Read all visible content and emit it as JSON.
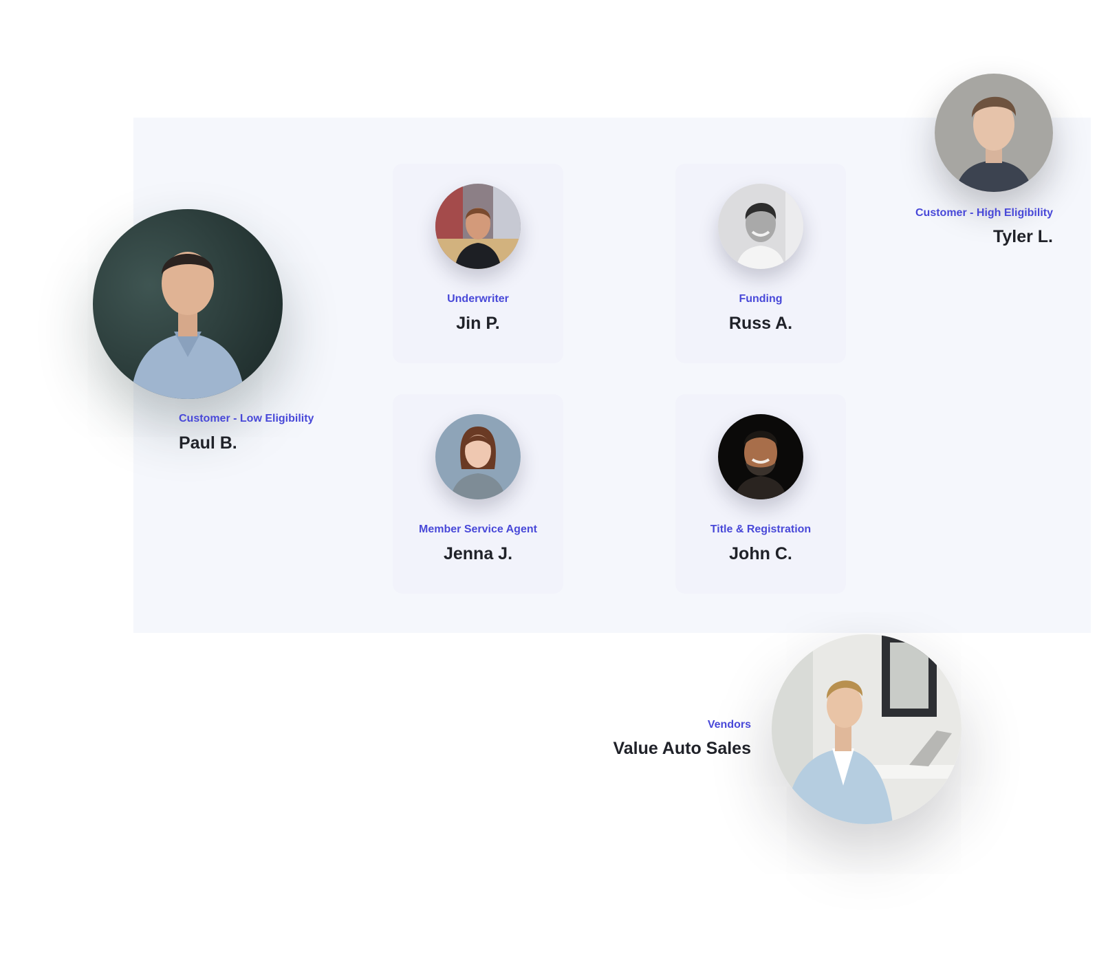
{
  "people": {
    "low": {
      "role": "Customer - Low Eligibility",
      "name": "Paul B."
    },
    "high": {
      "role": "Customer - High Eligibility",
      "name": "Tyler L."
    },
    "underwriter": {
      "role": "Underwriter",
      "name": "Jin P."
    },
    "funding": {
      "role": "Funding",
      "name": "Russ A."
    },
    "member": {
      "role": "Member Service Agent",
      "name": "Jenna J."
    },
    "title": {
      "role": "Title & Registration",
      "name": "John C."
    },
    "vendors": {
      "role": "Vendors",
      "name": "Value Auto Sales"
    }
  },
  "colors": {
    "accent": "#4848d8",
    "name_text": "#202229",
    "panel_bg": "#f5f7fc",
    "card_bg": "#f2f3fb"
  }
}
